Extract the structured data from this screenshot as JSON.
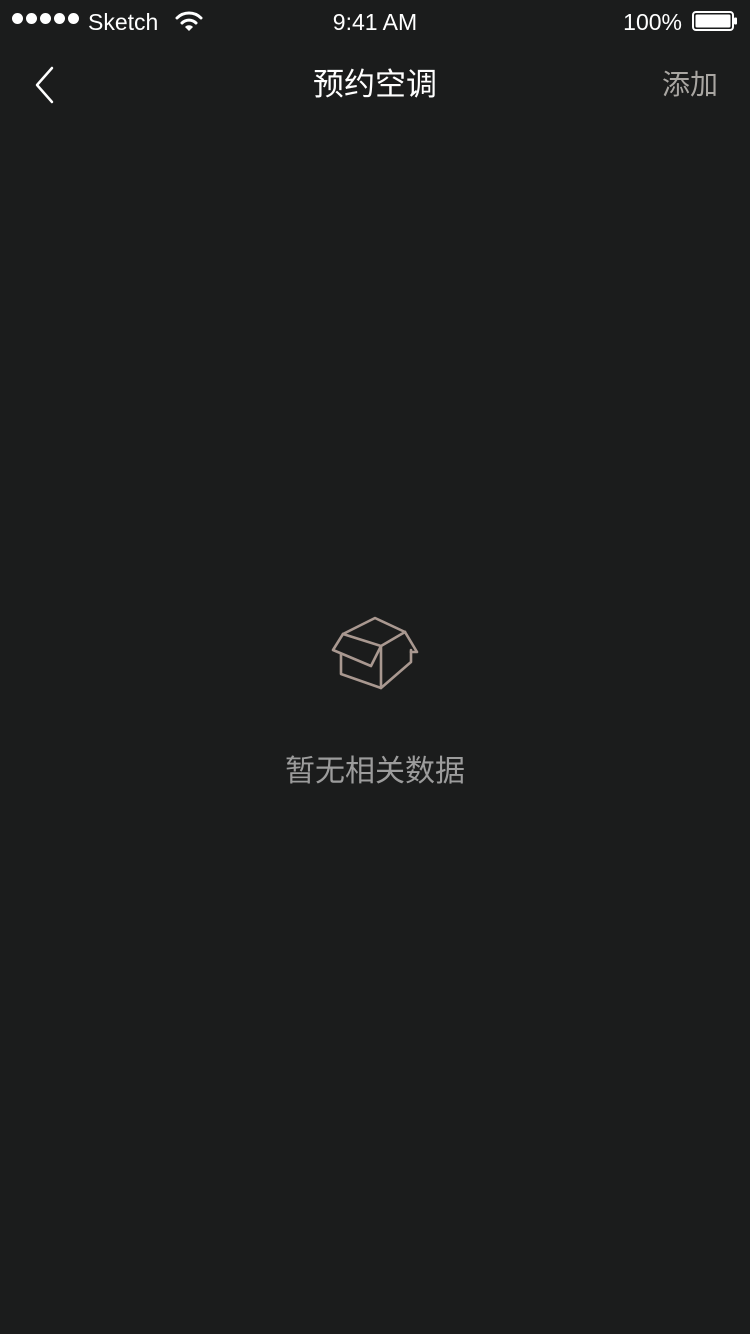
{
  "status_bar": {
    "carrier": "Sketch",
    "time": "9:41 AM",
    "battery_percent": "100%",
    "battery_level": 1.0,
    "signal_bars": 5,
    "signal_icon": "signal-dots-icon",
    "wifi_icon": "wifi-icon",
    "battery_icon": "battery-icon"
  },
  "nav": {
    "back_icon": "chevron-left-icon",
    "title": "预约空调",
    "add_label": "添加"
  },
  "empty": {
    "icon": "open-box-icon",
    "message": "暂无相关数据"
  },
  "colors": {
    "background": "#1b1c1c",
    "title": "#ffffff",
    "add_label": "#a9a6a2",
    "empty_icon": "#a99890",
    "empty_text": "#9c9c9c"
  }
}
